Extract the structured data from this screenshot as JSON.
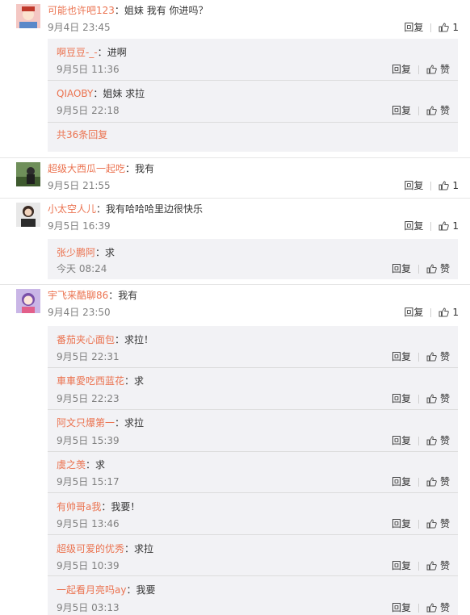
{
  "ui": {
    "reply_label": "回复",
    "like_label": "赞",
    "colon": "："
  },
  "comments": [
    {
      "user": "可能也许吧123",
      "text": "姐妹 我有 你进吗？",
      "time": "9月4日 23:45",
      "likes": "1",
      "replies": [
        {
          "user": "啊豆豆-_-",
          "text": "进啊",
          "time": "9月5日 11:36"
        },
        {
          "user": "QIAOBY",
          "text": "姐妹 求拉",
          "time": "9月5日 22:18"
        }
      ],
      "more_link": "共36条回复"
    },
    {
      "user": "超级大西瓜一起吃",
      "text": "我有",
      "time": "9月5日 21:55",
      "likes": "1"
    },
    {
      "user": "小太空人儿",
      "text": "我有哈哈哈里边很快乐",
      "time": "9月5日 16:39",
      "likes": "1",
      "replies": [
        {
          "user": "张少鹏阿",
          "text": "求",
          "time": "今天 08:24"
        }
      ]
    },
    {
      "user": "宇飞来酷聊86",
      "text": "我有",
      "time": "9月4日 23:50",
      "likes": "1",
      "replies": [
        {
          "user": "番茄夹心面包",
          "text": "求拉！",
          "time": "9月5日 22:31"
        },
        {
          "user": "車車愛吃西蓝花",
          "text": "求",
          "time": "9月5日 22:23"
        },
        {
          "user": "阿文只爆第一",
          "text": "求拉",
          "time": "9月5日 15:39"
        },
        {
          "user": "虞之羡",
          "text": "求",
          "time": "9月5日 15:17"
        },
        {
          "user": "有帅哥a我",
          "text": "我要！",
          "time": "9月5日 13:46"
        },
        {
          "user": "超级可爱的优秀",
          "text": "求拉",
          "time": "9月5日 10:39"
        },
        {
          "user": "一起看月亮吗ay",
          "text": "我要",
          "time": "9月5日 03:13"
        }
      ]
    }
  ],
  "colors": {
    "username": "#eb7350",
    "reply_bg": "#f2f2f5",
    "meta": "#808080"
  }
}
